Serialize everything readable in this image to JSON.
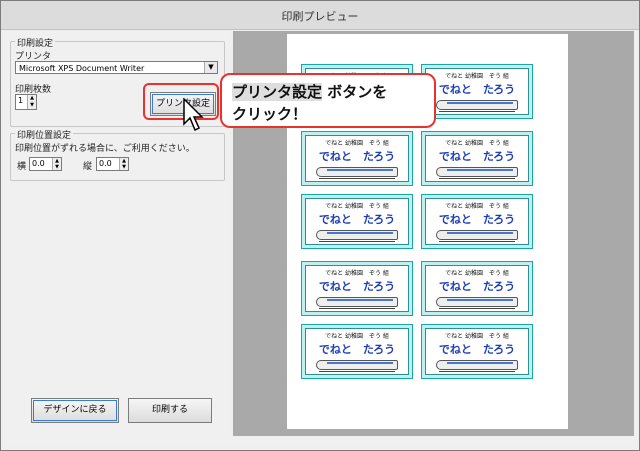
{
  "window": {
    "title": "印刷プレビュー"
  },
  "print_settings": {
    "legend": "印刷設定",
    "printer_label": "プリンタ",
    "printer_value": "Microsoft XPS Document Writer",
    "copies_label": "印刷枚数",
    "copies_value": "1",
    "printer_settings_button": "プリンタ設定"
  },
  "position_settings": {
    "legend": "印刷位置設定",
    "description": "印刷位置がずれる場合に、ご利用ください。",
    "horizontal_label": "横",
    "horizontal_value": "0.0",
    "vertical_label": "縦",
    "vertical_value": "0.0"
  },
  "buttons": {
    "back_to_design": "デザインに戻る",
    "print": "印刷する"
  },
  "card": {
    "top_text": "でねと 幼稚園　ぞう 組",
    "name_text": "でねと　たろう"
  },
  "callout": {
    "line1_highlight": "プリンタ設定",
    "line1_rest": " ボタンを",
    "line2": "クリック！",
    "border_color": "#e8322d"
  }
}
